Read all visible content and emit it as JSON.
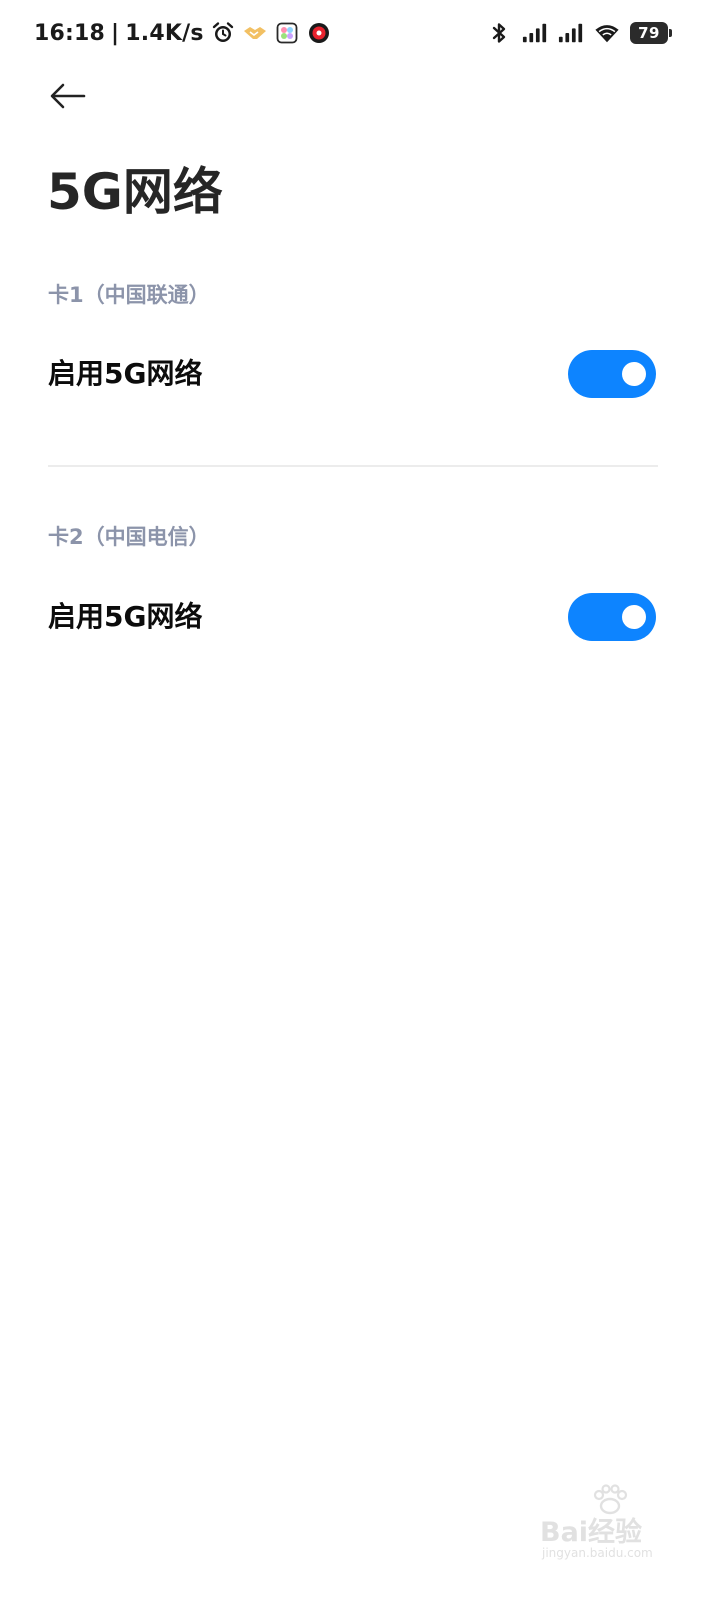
{
  "status_bar": {
    "time": "16:18",
    "separator": "|",
    "network_speed": "1.4K/s",
    "battery_level": "79",
    "left_icons": [
      "alarm-icon",
      "handshake-app-icon",
      "gallery-app-icon",
      "red-dot-app-icon"
    ],
    "right_icons": [
      "bluetooth-icon",
      "signal-sim1-icon",
      "signal-sim2-icon",
      "wifi-icon",
      "battery-icon"
    ]
  },
  "header": {
    "back_icon": "arrow-left-icon",
    "title": "5G网络"
  },
  "sections": [
    {
      "header": "卡1（中国联通）",
      "setting_label": "启用5G网络",
      "toggle_on": true
    },
    {
      "header": "卡2（中国电信）",
      "setting_label": "启用5G网络",
      "toggle_on": true
    }
  ],
  "watermark": {
    "main": "Bai经验",
    "sub": "jingyan.baidu.com"
  },
  "colors": {
    "accent": "#0d84ff",
    "section_header": "#8c94aa",
    "title": "#262626",
    "divider": "#ececec"
  }
}
